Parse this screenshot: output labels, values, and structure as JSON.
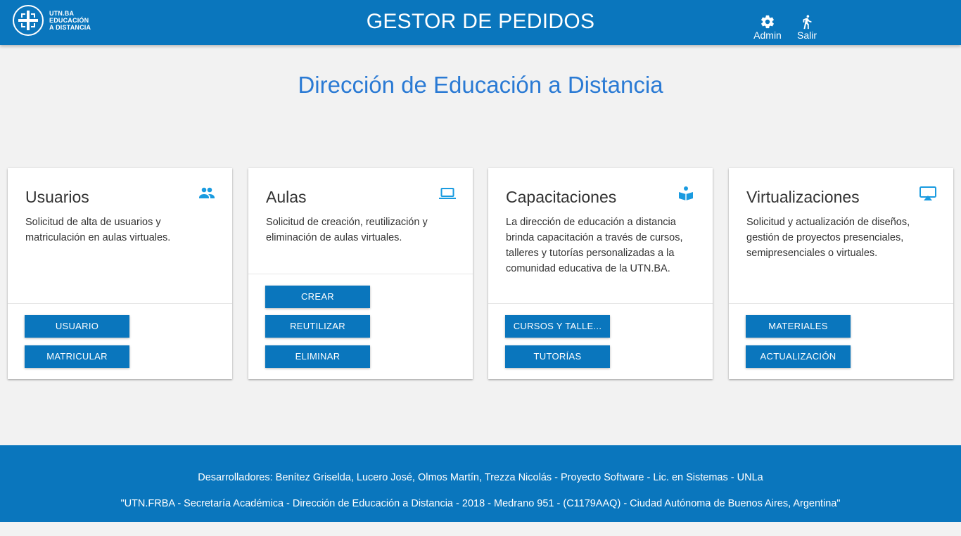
{
  "header": {
    "logo_lines": [
      "UTN.BA",
      "EDUCACIÓN",
      "A DISTANCIA"
    ],
    "title": "GESTOR DE PEDIDOS",
    "admin_label": "Admin",
    "admin_icon": "gear-icon",
    "salir_label": "Salir",
    "salir_icon": "running-person-icon"
  },
  "heading": "Dirección de Educación a Distancia",
  "cards": [
    {
      "title": "Usuarios",
      "icon": "people-icon",
      "text": "Solicitud de alta de usuarios y matriculación en aulas virtuales.",
      "buttons": [
        "USUARIO",
        "MATRICULAR"
      ]
    },
    {
      "title": "Aulas",
      "icon": "laptop-icon",
      "text": "Solicitud de creación, reutilización y eliminación de aulas virtuales.",
      "buttons": [
        "CREAR",
        "REUTILIZAR",
        "ELIMINAR"
      ]
    },
    {
      "title": "Capacitaciones",
      "icon": "book-reader-icon",
      "text": "La dirección de educación a distancia brinda capacitación a través de cursos, talleres y tutorías personalizadas a la comunidad educativa de la UTN.BA.",
      "buttons": [
        "CURSOS Y TALLE...",
        "TUTORÍAS"
      ]
    },
    {
      "title": "Virtualizaciones",
      "icon": "airplay-icon",
      "text": "Solicitud y actualización de diseños, gestión de proyectos presenciales, semipresenciales o virtuales.",
      "buttons": [
        "MATERIALES",
        "ACTUALIZACIÓN"
      ]
    }
  ],
  "footer": {
    "line1": "Desarrolladores: Benítez Griselda, Lucero José, Olmos Martín, Trezza Nicolás - Proyecto Software - Lic. en Sistemas - UNLa",
    "line2": "\"UTN.FRBA - Secretaría Académica - Dirección de Educación a Distancia - 2018 - Medrano 951 - (C1179AAQ) - Ciudad Autónoma de Buenos Aires, Argentina\""
  },
  "colors": {
    "primary": "#0a76bd",
    "heading": "#2a7ad4",
    "icon": "#1a9be0",
    "background": "#f2f2f2"
  }
}
